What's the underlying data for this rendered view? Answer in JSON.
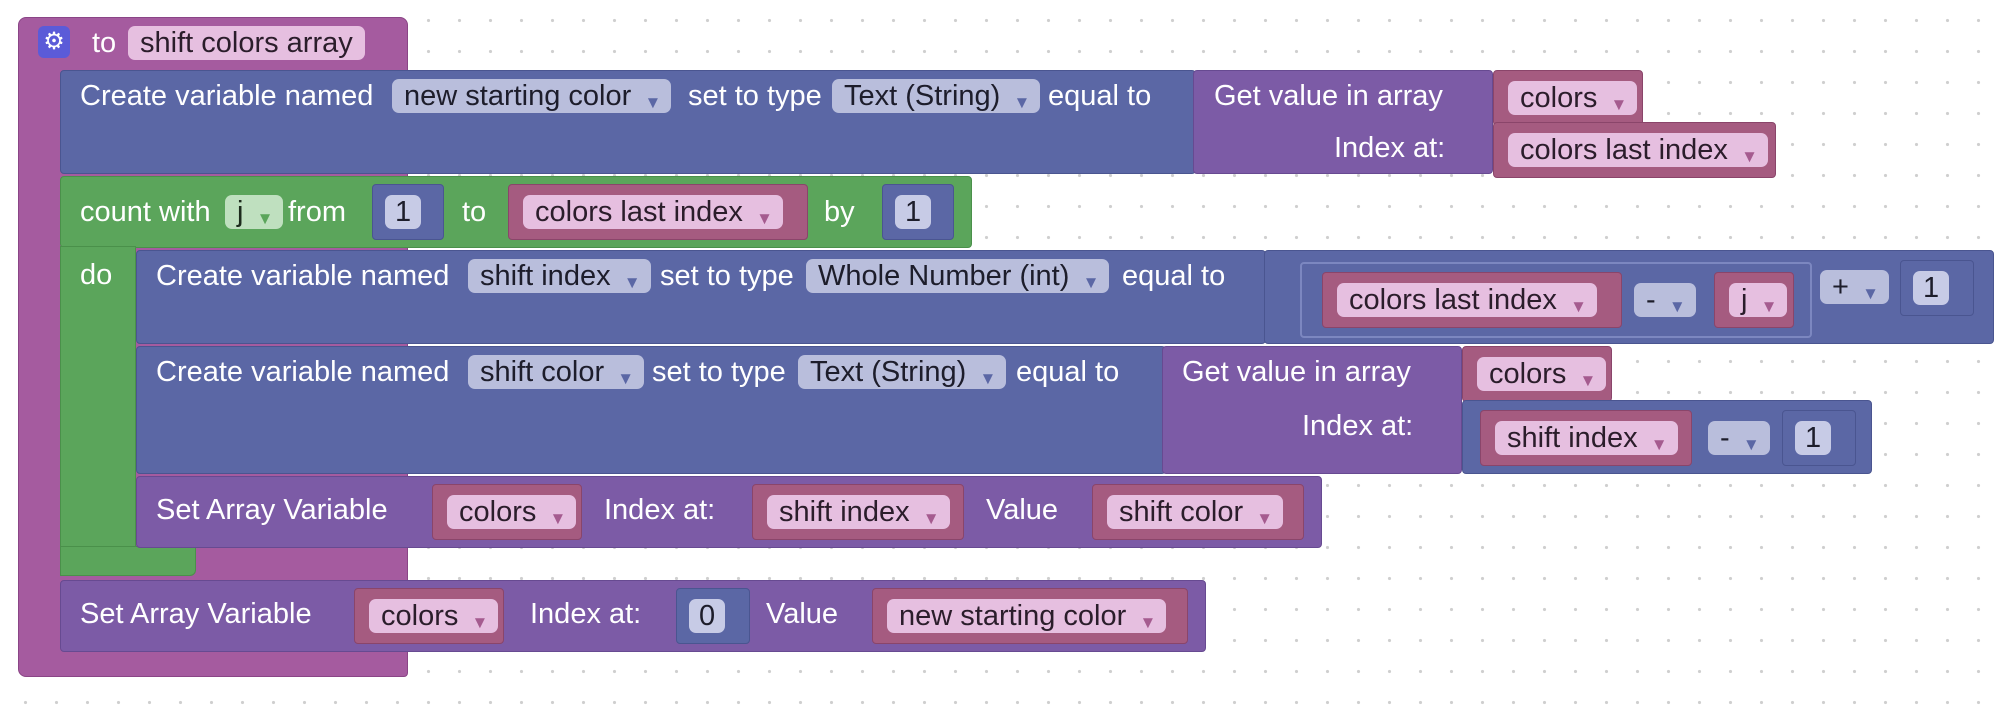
{
  "procedure": {
    "to_label": "to",
    "name": "shift colors array",
    "icon": "gear-icon"
  },
  "create_new_start": {
    "label1": "Create variable named",
    "var_name": "new starting color",
    "label2": "set to type",
    "type": "Text (String)",
    "label3": "equal to",
    "get_label": "Get value in array",
    "array_name": "colors",
    "index_label": "Index at:",
    "index_value": "colors last index"
  },
  "count_loop": {
    "label": "count with",
    "var": "j",
    "from_label": "from",
    "from_value": "1",
    "to_label": "to",
    "to_value": "colors last index",
    "by_label": "by",
    "by_value": "1",
    "do_label": "do"
  },
  "create_shift_index": {
    "label1": "Create variable named",
    "var_name": "shift index",
    "label2": "set to type",
    "type": "Whole Number (int)",
    "label3": "equal to",
    "inner_left": "colors last index",
    "inner_op": "-",
    "inner_right": "j",
    "outer_op": "+",
    "outer_right": "1"
  },
  "create_shift_color": {
    "label1": "Create variable named",
    "var_name": "shift color",
    "label2": "set to type",
    "type": "Text (String)",
    "label3": "equal to",
    "get_label": "Get value in array",
    "array_name": "colors",
    "index_label": "Index at:",
    "index_left": "shift index",
    "index_op": "-",
    "index_right": "1"
  },
  "set_in_loop": {
    "label": "Set Array Variable",
    "array_name": "colors",
    "index_label": "Index at:",
    "index_value": "shift index",
    "value_label": "Value",
    "value": "shift color"
  },
  "set_final": {
    "label": "Set Array Variable",
    "array_name": "colors",
    "index_label": "Index at:",
    "index_value": "0",
    "value_label": "Value",
    "value": "new starting color"
  },
  "colors": {
    "procedure": "#a55b9f",
    "variable": "#5b67a5",
    "array": "#7c5ba6",
    "loop": "#5ba55b",
    "reporter": "#a55b80"
  }
}
